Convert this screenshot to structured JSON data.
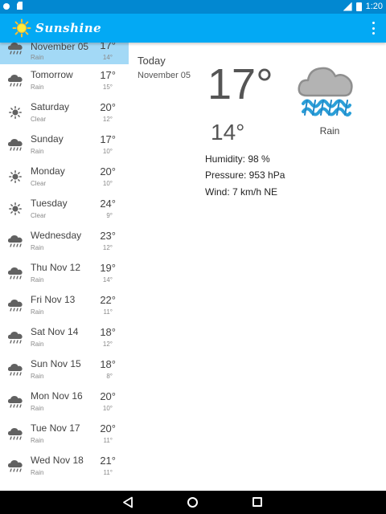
{
  "status_bar": {
    "time": "1:20",
    "icons": [
      "settings-icon",
      "sd-card-icon",
      "signal-icon",
      "battery-icon"
    ]
  },
  "app_bar": {
    "title": "Sunshine",
    "logo_icon": "sun-icon",
    "menu_icon": "overflow-menu-icon"
  },
  "forecast": [
    {
      "day": "Today,\nNovember 05",
      "desc": "Rain",
      "high": "17°",
      "low": "14°",
      "icon": "rain-cloud-icon",
      "selected": true
    },
    {
      "day": "Tomorrow",
      "desc": "Rain",
      "high": "17°",
      "low": "15°",
      "icon": "rain-cloud-icon"
    },
    {
      "day": "Saturday",
      "desc": "Clear",
      "high": "20°",
      "low": "12°",
      "icon": "sun-icon"
    },
    {
      "day": "Sunday",
      "desc": "Rain",
      "high": "17°",
      "low": "10°",
      "icon": "rain-cloud-icon"
    },
    {
      "day": "Monday",
      "desc": "Clear",
      "high": "20°",
      "low": "10°",
      "icon": "sun-icon"
    },
    {
      "day": "Tuesday",
      "desc": "Clear",
      "high": "24°",
      "low": "9°",
      "icon": "sun-icon"
    },
    {
      "day": "Wednesday",
      "desc": "Rain",
      "high": "23°",
      "low": "12°",
      "icon": "rain-cloud-icon"
    },
    {
      "day": "Thu Nov 12",
      "desc": "Rain",
      "high": "19°",
      "low": "14°",
      "icon": "rain-cloud-icon"
    },
    {
      "day": "Fri Nov 13",
      "desc": "Rain",
      "high": "22°",
      "low": "11°",
      "icon": "rain-cloud-icon"
    },
    {
      "day": "Sat Nov 14",
      "desc": "Rain",
      "high": "18°",
      "low": "12°",
      "icon": "rain-cloud-icon"
    },
    {
      "day": "Sun Nov 15",
      "desc": "Rain",
      "high": "18°",
      "low": "8°",
      "icon": "rain-cloud-icon"
    },
    {
      "day": "Mon Nov 16",
      "desc": "Rain",
      "high": "20°",
      "low": "10°",
      "icon": "rain-cloud-icon"
    },
    {
      "day": "Tue Nov 17",
      "desc": "Rain",
      "high": "20°",
      "low": "11°",
      "icon": "rain-cloud-icon"
    },
    {
      "day": "Wed Nov 18",
      "desc": "Rain",
      "high": "21°",
      "low": "11°",
      "icon": "rain-cloud-icon"
    }
  ],
  "detail": {
    "day": "Today",
    "date": "November 05",
    "high": "17°",
    "low": "14°",
    "description": "Rain",
    "icon": "rain-cloud-large-icon",
    "humidity": "Humidity: 98 %",
    "pressure": "Pressure: 953 hPa",
    "wind": "Wind: 7 km/h NE"
  },
  "nav_bar": {
    "back_icon": "back-icon",
    "home_icon": "home-icon",
    "recents_icon": "recents-icon"
  },
  "colors": {
    "status_bar": "#0288d1",
    "app_bar": "#03a9f4",
    "selected_row": "#a3d9f6",
    "rain_blue": "#2b9fd8",
    "cloud_gray": "#9e9e9e"
  }
}
